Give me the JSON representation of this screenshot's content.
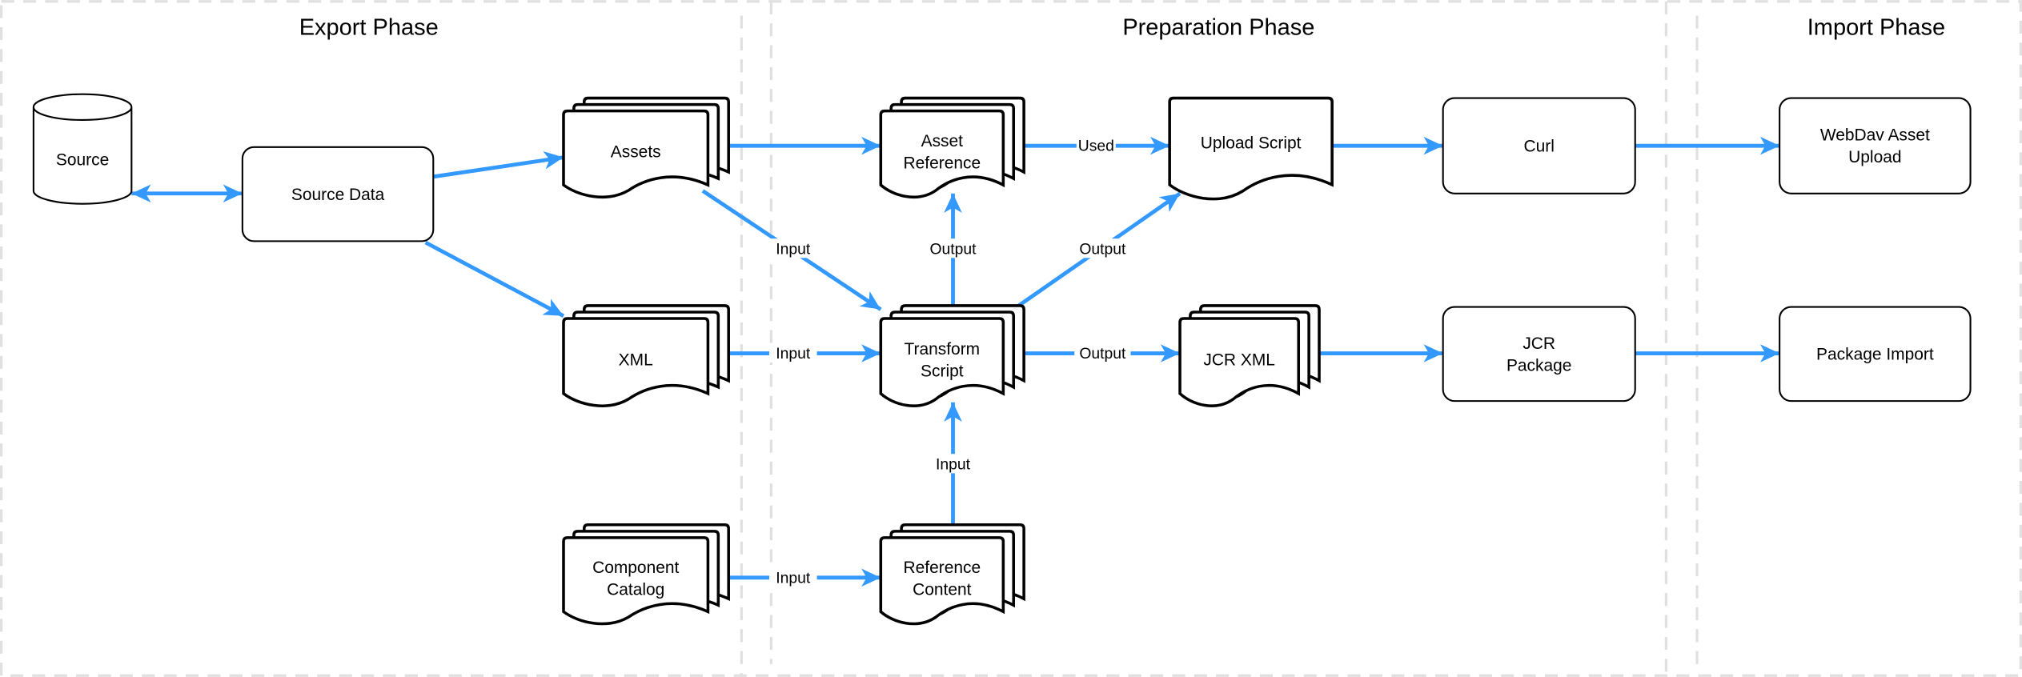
{
  "colors": {
    "edge": "#3399ff",
    "lane_border": "#e0e0e0",
    "shape_stroke": "#000000"
  },
  "phases": [
    {
      "id": "export",
      "title": "Export Phase"
    },
    {
      "id": "preparation",
      "title": "Preparation Phase"
    },
    {
      "id": "import",
      "title": "Import Phase"
    }
  ],
  "nodes": [
    {
      "id": "source",
      "shape": "cylinder",
      "lines": [
        "Source"
      ]
    },
    {
      "id": "source-data",
      "shape": "rounded-rect",
      "lines": [
        "Source Data"
      ]
    },
    {
      "id": "assets",
      "shape": "multi-document",
      "lines": [
        "Assets"
      ]
    },
    {
      "id": "xml",
      "shape": "multi-document",
      "lines": [
        "XML"
      ]
    },
    {
      "id": "component-catalog",
      "shape": "multi-document",
      "lines": [
        "Component",
        "Catalog"
      ]
    },
    {
      "id": "asset-reference",
      "shape": "multi-document",
      "lines": [
        "Asset",
        "Reference"
      ]
    },
    {
      "id": "transform-script",
      "shape": "multi-document",
      "lines": [
        "Transform",
        "Script"
      ]
    },
    {
      "id": "reference-content",
      "shape": "multi-document",
      "lines": [
        "Reference",
        "Content"
      ]
    },
    {
      "id": "upload-script",
      "shape": "document",
      "lines": [
        "Upload Script"
      ]
    },
    {
      "id": "jcr-xml",
      "shape": "multi-document",
      "lines": [
        "JCR XML"
      ]
    },
    {
      "id": "curl",
      "shape": "rounded-rect",
      "lines": [
        "Curl"
      ]
    },
    {
      "id": "jcr-package",
      "shape": "rounded-rect",
      "lines": [
        "JCR",
        "Package"
      ]
    },
    {
      "id": "webdav-asset-upload",
      "shape": "rounded-rect",
      "lines": [
        "WebDav Asset",
        "Upload"
      ]
    },
    {
      "id": "package-import",
      "shape": "rounded-rect",
      "lines": [
        "Package Import"
      ]
    }
  ],
  "edges": [
    {
      "from": "source",
      "to": "source-data",
      "label": "",
      "bidirectional": true
    },
    {
      "from": "source-data",
      "to": "assets",
      "label": ""
    },
    {
      "from": "source-data",
      "to": "xml",
      "label": ""
    },
    {
      "from": "assets",
      "to": "asset-reference",
      "label": ""
    },
    {
      "from": "assets",
      "to": "transform-script",
      "label": "Input"
    },
    {
      "from": "xml",
      "to": "transform-script",
      "label": "Input"
    },
    {
      "from": "component-catalog",
      "to": "reference-content",
      "label": "Input"
    },
    {
      "from": "asset-reference",
      "to": "upload-script",
      "label": "Used"
    },
    {
      "from": "transform-script",
      "to": "asset-reference",
      "label": "Output"
    },
    {
      "from": "transform-script",
      "to": "upload-script",
      "label": "Output"
    },
    {
      "from": "transform-script",
      "to": "jcr-xml",
      "label": "Output"
    },
    {
      "from": "reference-content",
      "to": "transform-script",
      "label": "Input"
    },
    {
      "from": "upload-script",
      "to": "curl",
      "label": ""
    },
    {
      "from": "curl",
      "to": "webdav-asset-upload",
      "label": ""
    },
    {
      "from": "jcr-xml",
      "to": "jcr-package",
      "label": ""
    },
    {
      "from": "jcr-package",
      "to": "package-import",
      "label": ""
    }
  ]
}
